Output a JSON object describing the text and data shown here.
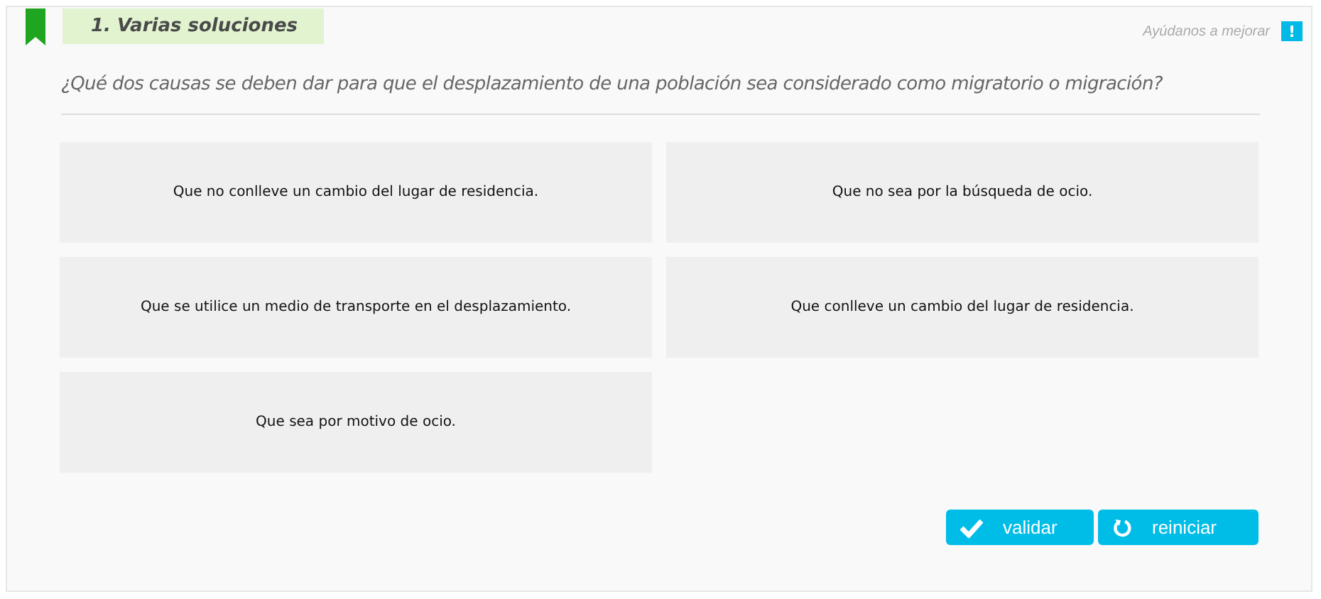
{
  "header": {
    "title": "1. Varias soluciones",
    "feedback_link": "Ayúdanos a mejorar",
    "feedback_icon": "!"
  },
  "question": "¿Qué dos causas se deben dar para que el desplazamiento de una población sea considerado como migratorio o migración?",
  "options": [
    {
      "label": "Que no conlleve un cambio del lugar de residencia.",
      "selected": false
    },
    {
      "label": "Que no sea por la búsqueda de ocio.",
      "selected": false
    },
    {
      "label": "Que se utilice un medio de transporte en el desplazamiento.",
      "selected": false
    },
    {
      "label": "Que conlleve un cambio del lugar de residencia.",
      "selected": false
    },
    {
      "label": "Que sea por motivo de ocio.",
      "selected": false
    }
  ],
  "buttons": [
    {
      "kind": "validate",
      "label": "validar"
    },
    {
      "kind": "reset",
      "label": "reiniciar"
    }
  ]
}
